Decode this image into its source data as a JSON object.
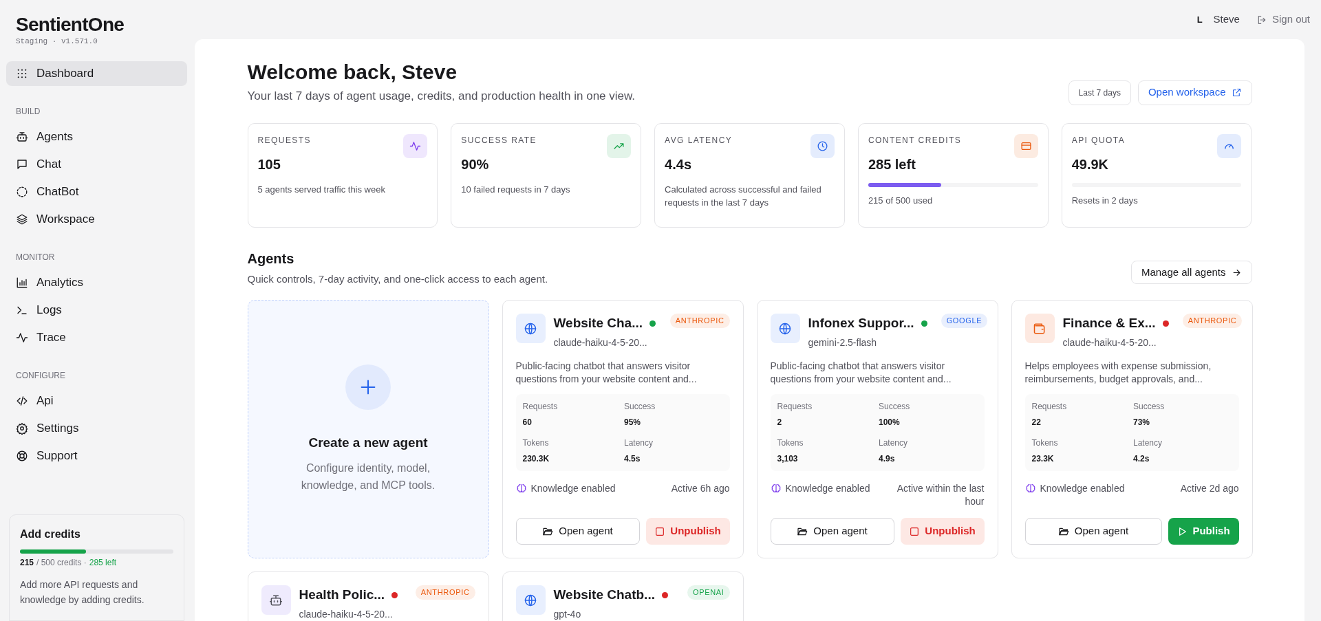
{
  "brand": {
    "name": "SentientOne",
    "env": "Staging · v1.571.0"
  },
  "sidebar": {
    "items": [
      {
        "label": "Dashboard",
        "selected": true
      }
    ],
    "sections": [
      {
        "title": "BUILD",
        "items": [
          {
            "label": "Agents",
            "selected": false
          },
          {
            "label": "Chat",
            "selected": false
          },
          {
            "label": "ChatBot",
            "selected": false
          },
          {
            "label": "Workspace",
            "selected": false
          }
        ]
      },
      {
        "title": "MONITOR",
        "items": [
          {
            "label": "Analytics",
            "selected": false
          },
          {
            "label": "Logs",
            "selected": false
          },
          {
            "label": "Trace",
            "selected": false
          }
        ]
      },
      {
        "title": "CONFIGURE",
        "items": [
          {
            "label": "Api",
            "selected": false
          },
          {
            "label": "Settings",
            "selected": false
          },
          {
            "label": "Support",
            "selected": false
          }
        ]
      }
    ],
    "credits": {
      "title": "Add credits",
      "level": 0.43,
      "used": "215",
      "total": "/ 500 credits ·",
      "left": "285 left",
      "note": "Add more API requests and knowledge by adding credits."
    }
  },
  "user": {
    "initial": "L",
    "name": "Steve",
    "sign_out": "Sign out"
  },
  "header": {
    "title": "Welcome back, Steve",
    "subtitle": "Your last 7 days of agent usage, credits, and production health in one view.",
    "range": "Last 7 days",
    "open": "Open workspace"
  },
  "stats": [
    {
      "label": "REQUESTS",
      "value": "105",
      "sub": "5 agents served traffic this week"
    },
    {
      "label": "SUCCESS RATE",
      "value": "90%",
      "sub": "10 failed requests in 7 days"
    },
    {
      "label": "AVG LATENCY",
      "value": "4.4s",
      "sub": "Calculated across successful and failed requests in the last 7 days"
    },
    {
      "label": "CONTENT CREDITS",
      "value": "285 left",
      "sub": "215 of 500 used",
      "level": 0.43
    },
    {
      "label": "API QUOTA",
      "value": "49.9K",
      "sub": "Resets in 2 days",
      "level": 0
    }
  ],
  "agents_section": {
    "title": "Agents",
    "subtitle": "Quick controls, 7-day activity, and one-click access to each agent.",
    "manage": "Manage all agents"
  },
  "create_card": {
    "title": "Create a new agent",
    "text": "Configure identity, model, knowledge, and MCP tools."
  },
  "agents": [
    {
      "name": "Website Cha...",
      "model": "claude-haiku-4-5-20...",
      "provider": "ANTHROPIC",
      "color": "#16a34a",
      "description": "Public-facing chatbot that answers visitor questions from your website content and...",
      "stats": [
        {
          "label": "Requests",
          "value": "60"
        },
        {
          "label": "Success",
          "value": "95%"
        },
        {
          "label": "Tokens",
          "value": "230.3K"
        },
        {
          "label": "Latency",
          "value": "4.5s"
        }
      ],
      "knowledge": "Knowledge enabled",
      "active": "Active 6h ago",
      "open": "Open agent",
      "action": {
        "kind": "unpublish",
        "label": "Unpublish"
      }
    },
    {
      "name": "Infonex Suppor...",
      "model": "gemini-2.5-flash",
      "provider": "GOOGLE",
      "color": "#16a34a",
      "description": "Public-facing chatbot that answers visitor questions from your website content and...",
      "stats": [
        {
          "label": "Requests",
          "value": "2"
        },
        {
          "label": "Success",
          "value": "100%"
        },
        {
          "label": "Tokens",
          "value": "3,103"
        },
        {
          "label": "Latency",
          "value": "4.9s"
        }
      ],
      "knowledge": "Knowledge enabled",
      "active": "Active within the last hour",
      "open": "Open agent",
      "action": {
        "kind": "unpublish",
        "label": "Unpublish"
      }
    },
    {
      "name": "Finance & Ex...",
      "model": "claude-haiku-4-5-20...",
      "provider": "ANTHROPIC",
      "color": "#dc2626",
      "description": "Helps employees with expense submission, reimbursements, budget approvals, and...",
      "stats": [
        {
          "label": "Requests",
          "value": "22"
        },
        {
          "label": "Success",
          "value": "73%"
        },
        {
          "label": "Tokens",
          "value": "23.3K"
        },
        {
          "label": "Latency",
          "value": "4.2s"
        }
      ],
      "knowledge": "Knowledge enabled",
      "active": "Active 2d ago",
      "open": "Open agent",
      "action": {
        "kind": "publish",
        "label": "Publish"
      }
    },
    {
      "name": "Health Polic...",
      "model": "claude-haiku-4-5-20...",
      "provider": "ANTHROPIC",
      "color": "#dc2626"
    },
    {
      "name": "Website Chatb...",
      "model": "gpt-4o",
      "provider": "OPENAI",
      "color": "#dc2626"
    }
  ]
}
